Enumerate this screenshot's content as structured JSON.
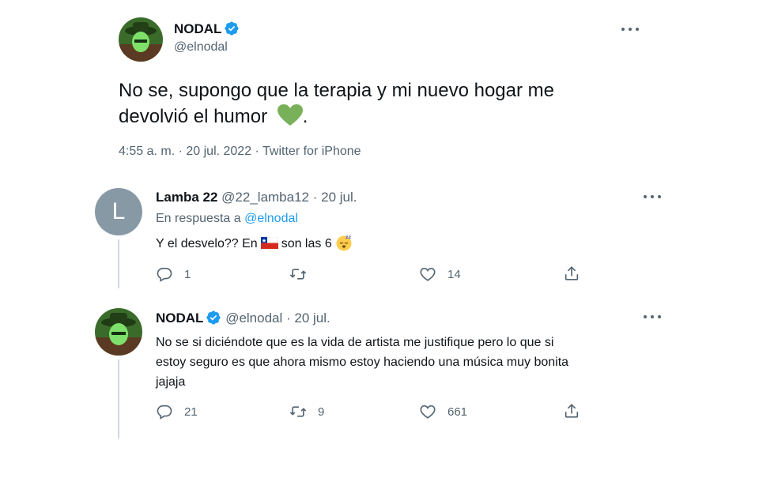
{
  "main_tweet": {
    "author_name": "NODAL",
    "author_handle": "@elnodal",
    "text_line1": "No se, supongo que la terapia y mi nuevo hogar me",
    "text_line2": "devolvió el humor",
    "emoji": "green-heart",
    "trailing": ".",
    "meta": "4:55 a. m. · 20 jul. 2022 · Twitter for iPhone"
  },
  "replies": [
    {
      "author_name": "Lamba 22",
      "author_handle": "@22_lamba12",
      "date": "· 20 jul.",
      "avatar_letter": "L",
      "reply_to_prefix": "En respuesta a",
      "reply_to_handle": "@elnodal",
      "text_before_flag": "Y el desvelo?? En",
      "text_after_flag": "son las 6",
      "actions": {
        "replies": "1",
        "retweets": "",
        "likes": "14"
      }
    },
    {
      "author_name": "NODAL",
      "author_handle": "@elnodal",
      "date": "· 20 jul.",
      "text_line1": "No se si diciéndote que es la vida de artista me justifique pero lo que si",
      "text_line2": "estoy seguro es que ahora mismo estoy haciendo una música muy bonita",
      "text_line3": "jajaja",
      "actions": {
        "replies": "21",
        "retweets": "9",
        "likes": "661"
      }
    }
  ],
  "colors": {
    "verified": "#1d9bf0",
    "link": "#1d9bf0",
    "muted": "#536471",
    "heart": "#78b159"
  }
}
